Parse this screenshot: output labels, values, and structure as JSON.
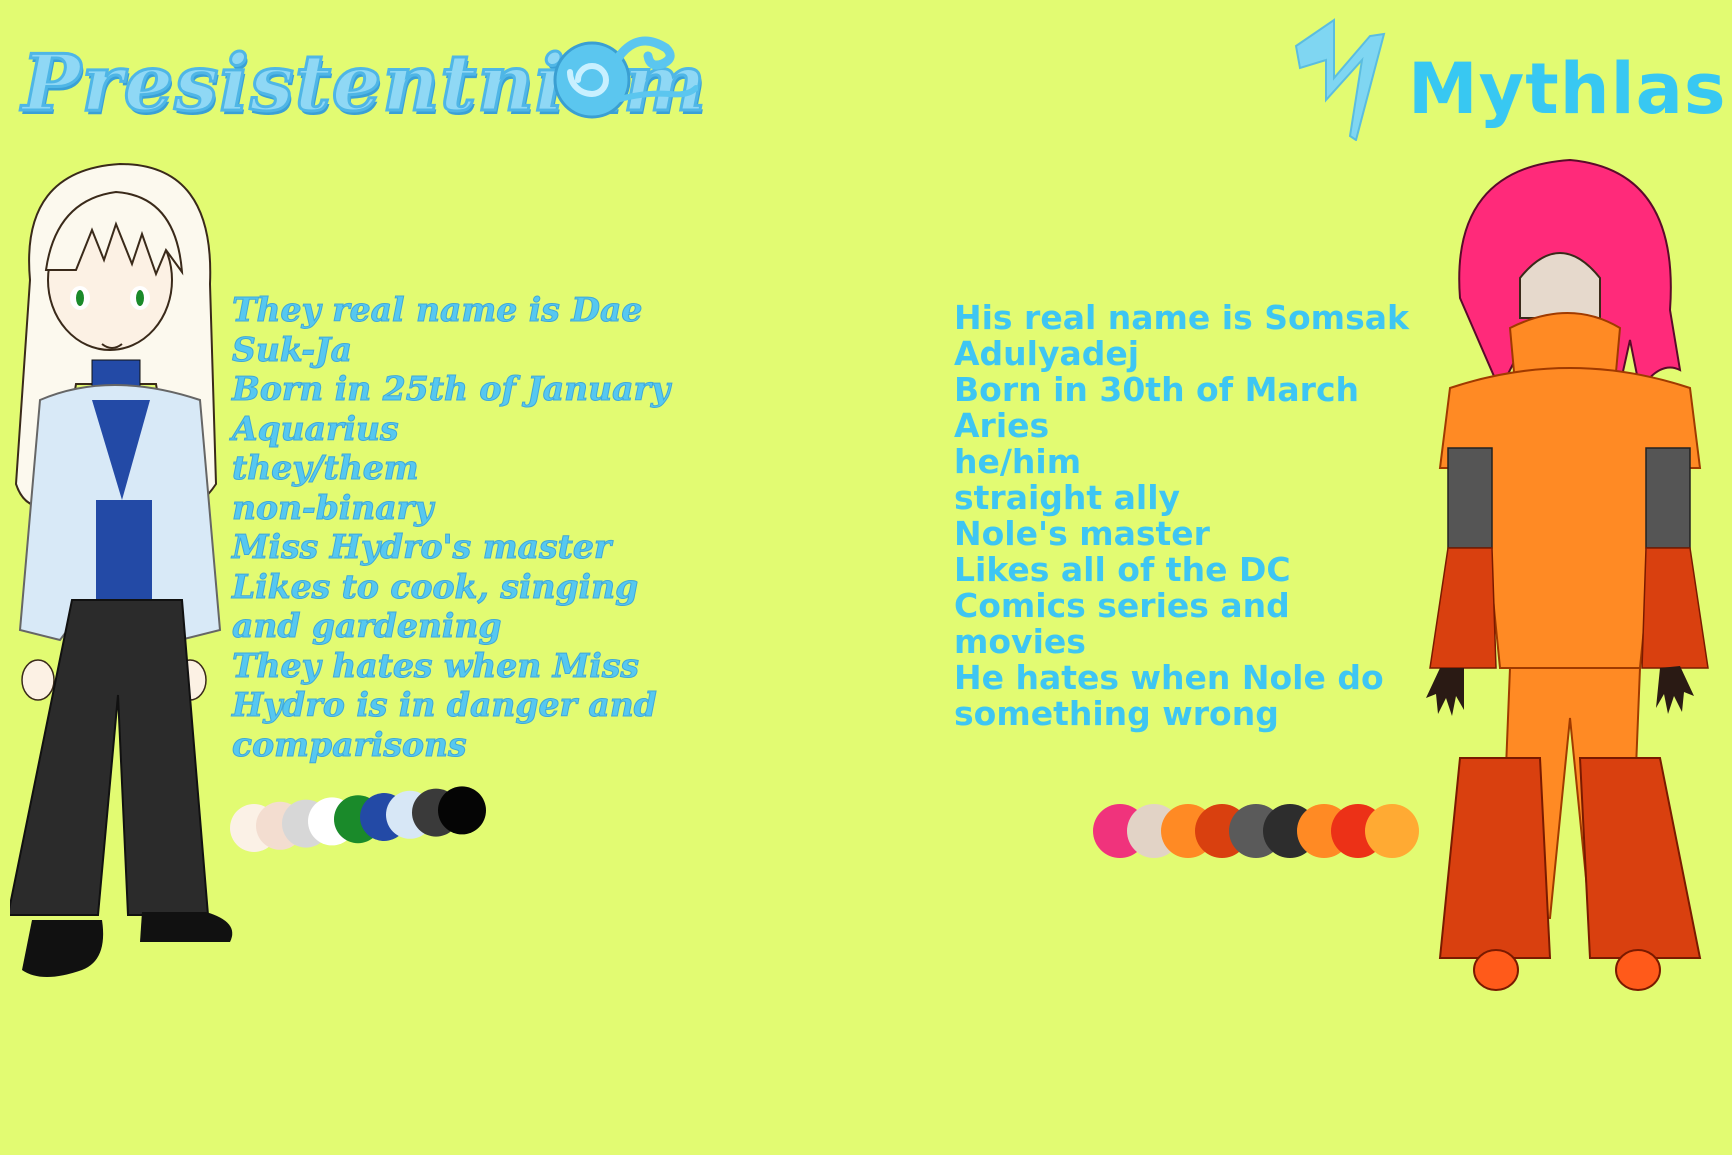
{
  "left_character": {
    "name": "Presistentnium",
    "emblem_icon": "wind-swirl-icon",
    "info": [
      "They real name is Dae",
      "Suk-Ja",
      "Born in 25th of January",
      "Aquarius",
      "they/them",
      "non-binary",
      "Miss Hydro's master",
      "Likes to cook, singing",
      "and gardening",
      "They hates when Miss",
      "Hydro is in danger and",
      "comparisons"
    ],
    "palette": [
      "#fbf1e6",
      "#f3ddd0",
      "#d7d7d7",
      "#ffffff",
      "#1a8a2a",
      "#234aa6",
      "#d7e7f6",
      "#3a3a3a",
      "#050505"
    ]
  },
  "right_character": {
    "name": "Mythlas",
    "emblem_icon": "lightning-bolt-icon",
    "info": [
      "His real name is Somsak",
      "Adulyadej",
      "Born in 30th of March",
      "Aries",
      "he/him",
      "straight ally",
      "Nole's master",
      "Likes all of the DC",
      "Comics series and",
      "movies",
      "He hates when Nole do",
      "something wrong"
    ],
    "palette": [
      "#f0337c",
      "#e2d3c6",
      "#ff8a24",
      "#d9400f",
      "#5a5a5a",
      "#2d2d2d",
      "#ff8a24",
      "#ec3117",
      "#ffaa33"
    ]
  },
  "colors": {
    "background": "#e2fb72",
    "left_title": "#8fd8f5",
    "right_title": "#38c8f2"
  }
}
